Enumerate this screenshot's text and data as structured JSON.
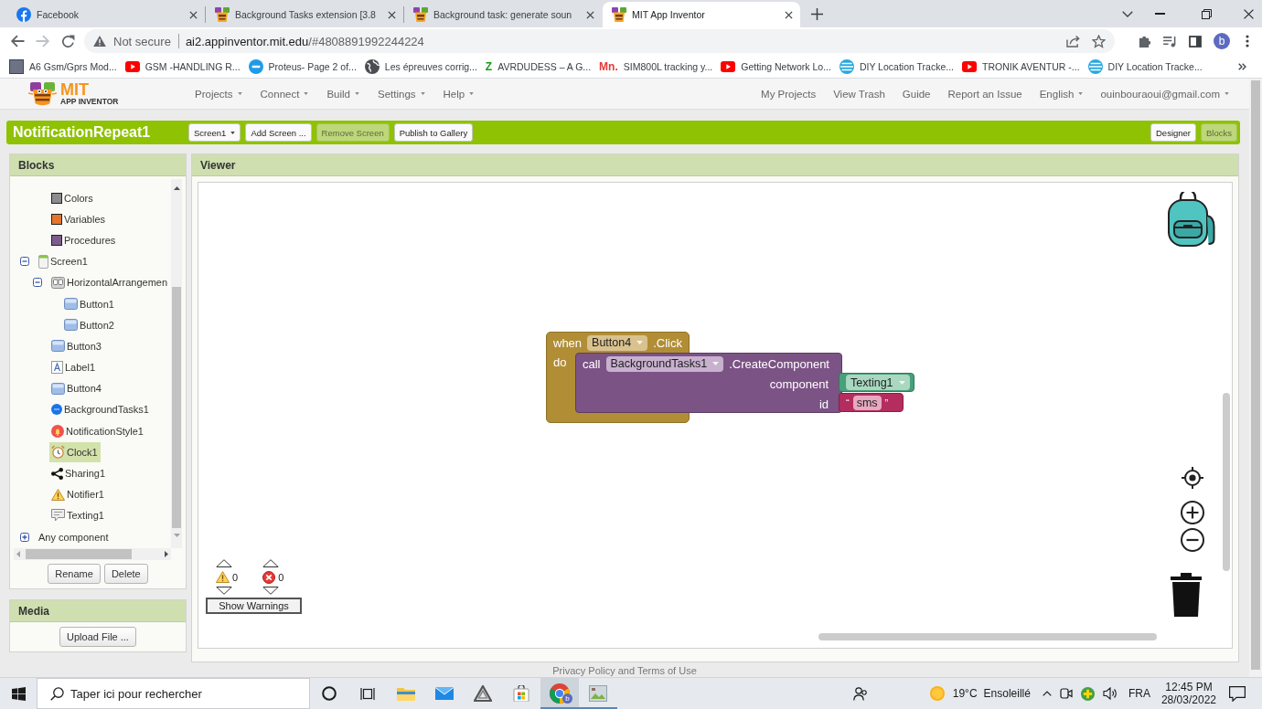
{
  "browser": {
    "tabs": [
      {
        "title": "Facebook",
        "kind": "facebook",
        "selected": false
      },
      {
        "title": "Background Tasks extension [3.8",
        "kind": "appinventor",
        "selected": false
      },
      {
        "title": "Background task: generate soun",
        "kind": "appinventor",
        "selected": false
      },
      {
        "title": "MIT App Inventor",
        "kind": "appinventor",
        "selected": true
      }
    ],
    "address": {
      "security": "Not secure",
      "host": "ai2.appinventor.mit.edu",
      "path": "/#4808891992244224"
    },
    "profile": "b",
    "bookmarks": [
      {
        "label": "A6 Gsm/Gprs Mod...",
        "kind": "photo"
      },
      {
        "label": "GSM -HANDLING R...",
        "kind": "video"
      },
      {
        "label": "Proteus- Page 2 of...",
        "kind": "badge"
      },
      {
        "label": "Les épreuves corrig...",
        "kind": "globe"
      },
      {
        "label": "AVRDUDESS – A G...",
        "kind": "letter",
        "mark": "Z",
        "color": "#169c16"
      },
      {
        "label": "SIM800L tracking y...",
        "kind": "letter",
        "mark": "Mn.",
        "color": "#e53935"
      },
      {
        "label": "Getting Network Lo...",
        "kind": "video"
      },
      {
        "label": "DIY Location Tracke...",
        "kind": "striped"
      },
      {
        "label": "TRONIK AVENTUR -...",
        "kind": "video"
      },
      {
        "label": "DIY Location Tracke...",
        "kind": "striped"
      }
    ]
  },
  "app": {
    "logo": {
      "line1": "MIT",
      "line2": "APP INVENTOR"
    },
    "menus": [
      {
        "label": "Projects",
        "dropdown": true
      },
      {
        "label": "Connect",
        "dropdown": true
      },
      {
        "label": "Build",
        "dropdown": true
      },
      {
        "label": "Settings",
        "dropdown": true
      },
      {
        "label": "Help",
        "dropdown": true
      }
    ],
    "links": [
      {
        "label": "My Projects",
        "dropdown": false
      },
      {
        "label": "View Trash",
        "dropdown": false
      },
      {
        "label": "Guide",
        "dropdown": false
      },
      {
        "label": "Report an Issue",
        "dropdown": false
      },
      {
        "label": "English",
        "dropdown": true
      },
      {
        "label": "ouinbouraoui@gmail.com",
        "dropdown": true
      }
    ],
    "project_name": "NotificationRepeat1",
    "project_buttons": [
      {
        "label": "Screen1",
        "dropdown": true,
        "disabled": false
      },
      {
        "label": "Add Screen ...",
        "dropdown": false,
        "disabled": false
      },
      {
        "label": "Remove Screen",
        "dropdown": false,
        "disabled": true
      },
      {
        "label": "Publish to Gallery",
        "dropdown": false,
        "disabled": false
      }
    ],
    "editor_buttons": [
      {
        "label": "Designer",
        "selected": false
      },
      {
        "label": "Blocks",
        "selected": true
      }
    ]
  },
  "blocks_panel": {
    "title": "Blocks",
    "tree": [
      {
        "label": "Colors",
        "kind": "category",
        "color": "#8c8c8c",
        "selected": false
      },
      {
        "label": "Variables",
        "kind": "category",
        "color": "#e3762c",
        "selected": false
      },
      {
        "label": "Procedures",
        "kind": "category",
        "color": "#7d5c8c",
        "selected": false
      },
      {
        "label": "Screen1",
        "kind": "screen",
        "expanded": true,
        "selected": false,
        "children": [
          {
            "label": "HorizontalArrangemen",
            "kind": "arrangement",
            "expanded": true,
            "selected": false,
            "children": [
              {
                "label": "Button1",
                "kind": "button",
                "selected": false
              },
              {
                "label": "Button2",
                "kind": "button",
                "selected": false
              }
            ]
          },
          {
            "label": "Button3",
            "kind": "button",
            "selected": false
          },
          {
            "label": "Label1",
            "kind": "label",
            "selected": false
          },
          {
            "label": "Button4",
            "kind": "button",
            "selected": false
          },
          {
            "label": "BackgroundTasks1",
            "kind": "extension",
            "selected": false
          },
          {
            "label": "NotificationStyle1",
            "kind": "notification",
            "selected": false
          },
          {
            "label": "Clock1",
            "kind": "clock",
            "selected": true
          },
          {
            "label": "Sharing1",
            "kind": "sharing",
            "selected": false
          },
          {
            "label": "Notifier1",
            "kind": "notifier",
            "selected": false
          },
          {
            "label": "Texting1",
            "kind": "texting",
            "selected": false
          }
        ]
      },
      {
        "label": "Any component",
        "kind": "group",
        "expanded": false,
        "selected": false
      }
    ],
    "buttons": [
      "Rename",
      "Delete"
    ]
  },
  "media_panel": {
    "title": "Media",
    "button": "Upload File ..."
  },
  "viewer": {
    "title": "Viewer",
    "event_block": {
      "when": "when",
      "component": "Button4",
      "event": ".Click",
      "do": "do",
      "call": {
        "keyword": "call",
        "component": "BackgroundTasks1",
        "method": ".CreateComponent",
        "args": [
          {
            "name": "component",
            "kind": "component",
            "value": "Texting1"
          },
          {
            "name": "id",
            "kind": "text",
            "open_quote": "“",
            "value": "sms",
            "close_quote": "”"
          }
        ]
      }
    },
    "warnings": {
      "warning_count": "0",
      "error_count": "0",
      "button": "Show Warnings"
    }
  },
  "footer": "Privacy Policy and Terms of Use",
  "taskbar": {
    "search": {
      "placeholder": "Taper ici pour rechercher"
    },
    "apps": [
      {
        "kind": "ring",
        "running": false,
        "active": false
      },
      {
        "kind": "task-view",
        "running": false,
        "active": false
      },
      {
        "kind": "folder",
        "running": false,
        "active": false
      },
      {
        "kind": "mail",
        "running": false,
        "active": false
      },
      {
        "kind": "triangle",
        "running": false,
        "active": false
      },
      {
        "kind": "store",
        "running": false,
        "active": false
      },
      {
        "kind": "browser",
        "running": true,
        "active": true,
        "badge": "b"
      },
      {
        "kind": "picture",
        "running": true,
        "active": false
      }
    ],
    "weather": {
      "temperature": "19°C",
      "condition": "Ensoleillé"
    },
    "language": "FRA",
    "time": "12:45 PM",
    "date": "28/03/2022"
  }
}
